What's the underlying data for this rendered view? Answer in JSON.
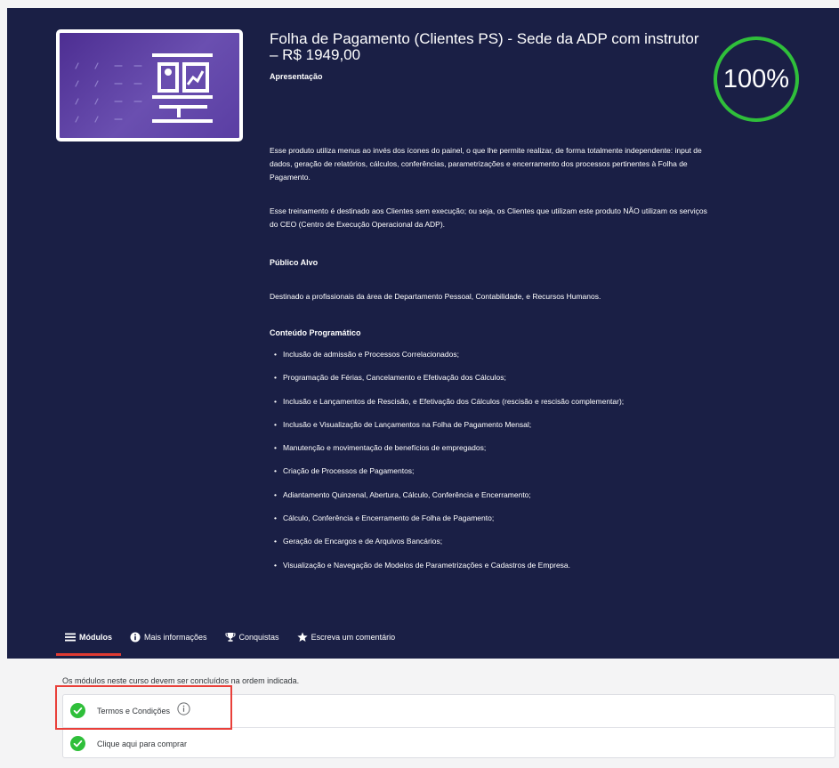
{
  "course": {
    "title": "Folha de Pagamento (Clientes PS) - Sede da ADP com instrutor – R$ 1949,00",
    "subtitle": "Apresentação",
    "progress": "100%",
    "progress_fraction": 1.0,
    "description_1": "Esse produto utiliza menus ao invés dos ícones do painel, o que lhe permite realizar, de forma totalmente independente: input de dados, geração de relatórios, cálculos, conferências, parametrizações e encerramento dos processos pertinentes à Folha de Pagamento.",
    "description_2": "Esse treinamento é destinado aos Clientes sem execução; ou seja, os Clientes que utilizam este produto NÃO utilizam os serviços do CEO (Centro de Execução Operacional da ADP).",
    "audience_heading": "Público Alvo",
    "audience_text": "Destinado a profissionais da área de Departamento Pessoal, Contabilidade, e Recursos Humanos.",
    "content_heading": "Conteúdo Programático",
    "content_items": [
      "Inclusão de admissão e Processos Correlacionados;",
      "Programação de Férias, Cancelamento e Efetivação dos Cálculos;",
      "Inclusão e Lançamentos de Rescisão, e Efetivação dos Cálculos (rescisão e rescisão complementar);",
      "Inclusão e Visualização de Lançamentos na Folha de Pagamento Mensal;",
      "Manutenção e movimentação de benefícios de empregados;",
      "Criação de Processos de Pagamentos;",
      "Adiantamento Quinzenal, Abertura, Cálculo, Conferência e Encerramento;",
      "Cálculo, Conferência e Encerramento de Folha de Pagamento;",
      "Geração de Encargos e de Arquivos Bancários;",
      "Visualização e Navegação de Modelos de Parametrizações e Cadastros de Empresa."
    ]
  },
  "tabs": [
    {
      "label": "Módulos",
      "icon": "list-icon"
    },
    {
      "label": "Mais informações",
      "icon": "info-circle-icon"
    },
    {
      "label": "Conquistas",
      "icon": "trophy-icon"
    },
    {
      "label": "Escreva um comentário",
      "icon": "star-icon"
    }
  ],
  "modules_notice": "Os módulos neste curso devem ser concluídos na ordem indicada.",
  "modules": [
    {
      "label": "Termos e Condições",
      "status": "completed"
    },
    {
      "label": "Clique aqui para comprar",
      "status": "completed"
    }
  ],
  "colors": {
    "hero_bg": "#1a1f45",
    "accent_red": "#e03a32",
    "success_green": "#2fbf3a"
  }
}
